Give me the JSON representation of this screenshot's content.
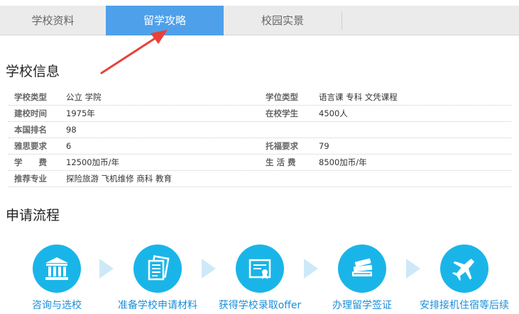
{
  "tabs": [
    {
      "label": "学校资料"
    },
    {
      "label": "留学攻略"
    },
    {
      "label": "校园实景"
    }
  ],
  "accent_color": "#4fa0ea",
  "annotation_color": "#e8413a",
  "school_info": {
    "title": "学校信息",
    "rows": [
      {
        "label1": "学校类型",
        "value1": "公立 学院",
        "label2": "学位类型",
        "value2": "语言课 专科 文凭课程"
      },
      {
        "label1": "建校时间",
        "value1": "1975年",
        "label2": "在校学生",
        "value2": "4500人"
      },
      {
        "label1": "本国排名",
        "value1": "98",
        "label2": "",
        "value2": ""
      },
      {
        "label1": "雅思要求",
        "value1": "6",
        "label2": "托福要求",
        "value2": "79"
      },
      {
        "label1": "学　　费",
        "value1": "12500加币/年",
        "label2": "生 活 费",
        "value2": "8500加币/年"
      },
      {
        "label1": "推荐专业",
        "value1": "探险旅游 飞机维修 商科 教育",
        "label2": "",
        "value2": ""
      }
    ]
  },
  "process": {
    "title": "申请流程",
    "step_color": "#1ab5e8",
    "steps": [
      {
        "label": "咨询与选校",
        "icon": "institution-icon"
      },
      {
        "label": "准备学校申请材料",
        "icon": "documents-icon"
      },
      {
        "label": "获得学校录取offer",
        "icon": "certificate-icon"
      },
      {
        "label": "办理留学签证",
        "icon": "books-icon"
      },
      {
        "label": "安排接机住宿等后续",
        "icon": "airplane-icon"
      }
    ]
  }
}
